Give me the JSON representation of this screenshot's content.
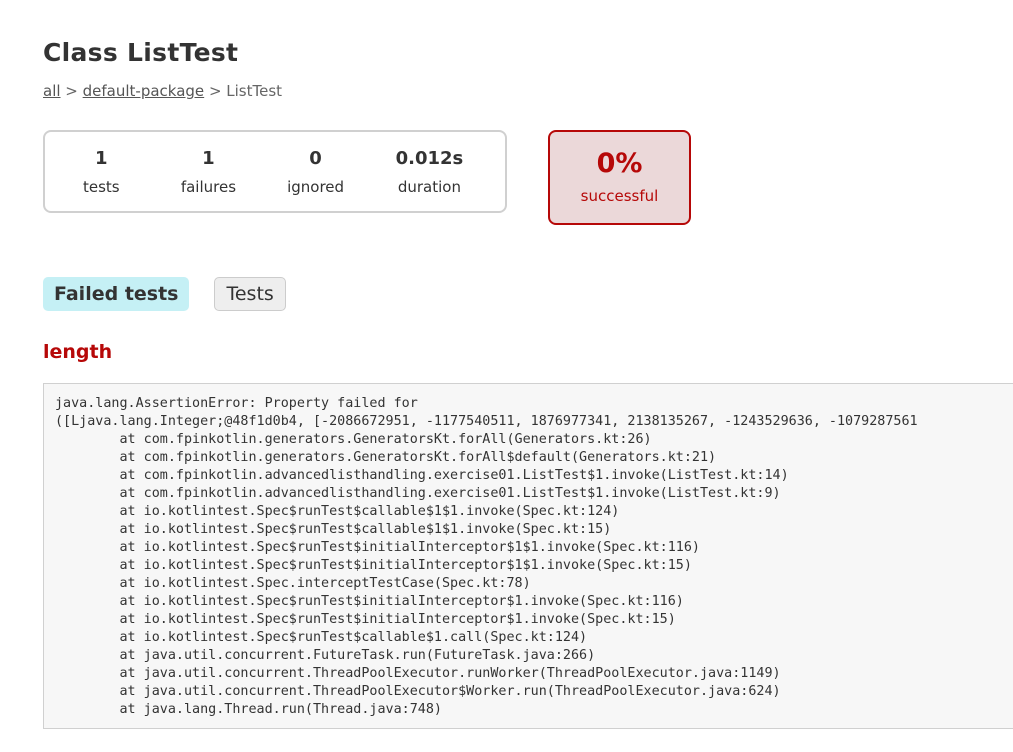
{
  "header": {
    "title": "Class ListTest",
    "breadcrumb": {
      "all": "all",
      "sep1": " > ",
      "package": "default-package",
      "sep2": " > ",
      "current": "ListTest"
    }
  },
  "summary": {
    "tests": {
      "value": "1",
      "label": "tests"
    },
    "failures": {
      "value": "1",
      "label": "failures"
    },
    "ignored": {
      "value": "0",
      "label": "ignored"
    },
    "duration": {
      "value": "0.012s",
      "label": "duration"
    },
    "success": {
      "value": "0%",
      "label": "successful"
    }
  },
  "tabs": [
    {
      "label": "Failed tests",
      "active": true
    },
    {
      "label": "Tests",
      "active": false
    }
  ],
  "failed_test": {
    "name": "length",
    "trace": "java.lang.AssertionError: Property failed for\n([Ljava.lang.Integer;@48f1d0b4, [-2086672951, -1177540511, 1876977341, 2138135267, -1243529636, -1079287561\n\tat com.fpinkotlin.generators.GeneratorsKt.forAll(Generators.kt:26)\n\tat com.fpinkotlin.generators.GeneratorsKt.forAll$default(Generators.kt:21)\n\tat com.fpinkotlin.advancedlisthandling.exercise01.ListTest$1.invoke(ListTest.kt:14)\n\tat com.fpinkotlin.advancedlisthandling.exercise01.ListTest$1.invoke(ListTest.kt:9)\n\tat io.kotlintest.Spec$runTest$callable$1$1.invoke(Spec.kt:124)\n\tat io.kotlintest.Spec$runTest$callable$1$1.invoke(Spec.kt:15)\n\tat io.kotlintest.Spec$runTest$initialInterceptor$1$1.invoke(Spec.kt:116)\n\tat io.kotlintest.Spec$runTest$initialInterceptor$1$1.invoke(Spec.kt:15)\n\tat io.kotlintest.Spec.interceptTestCase(Spec.kt:78)\n\tat io.kotlintest.Spec$runTest$initialInterceptor$1.invoke(Spec.kt:116)\n\tat io.kotlintest.Spec$runTest$initialInterceptor$1.invoke(Spec.kt:15)\n\tat io.kotlintest.Spec$runTest$callable$1.call(Spec.kt:124)\n\tat java.util.concurrent.FutureTask.run(FutureTask.java:266)\n\tat java.util.concurrent.ThreadPoolExecutor.runWorker(ThreadPoolExecutor.java:1149)\n\tat java.util.concurrent.ThreadPoolExecutor$Worker.run(ThreadPoolExecutor.java:624)\n\tat java.lang.Thread.run(Thread.java:748)"
  },
  "colors": {
    "failure": "#b60808",
    "failure_bg": "#ebd8d9",
    "active_tab_bg": "#c5f0f5"
  }
}
